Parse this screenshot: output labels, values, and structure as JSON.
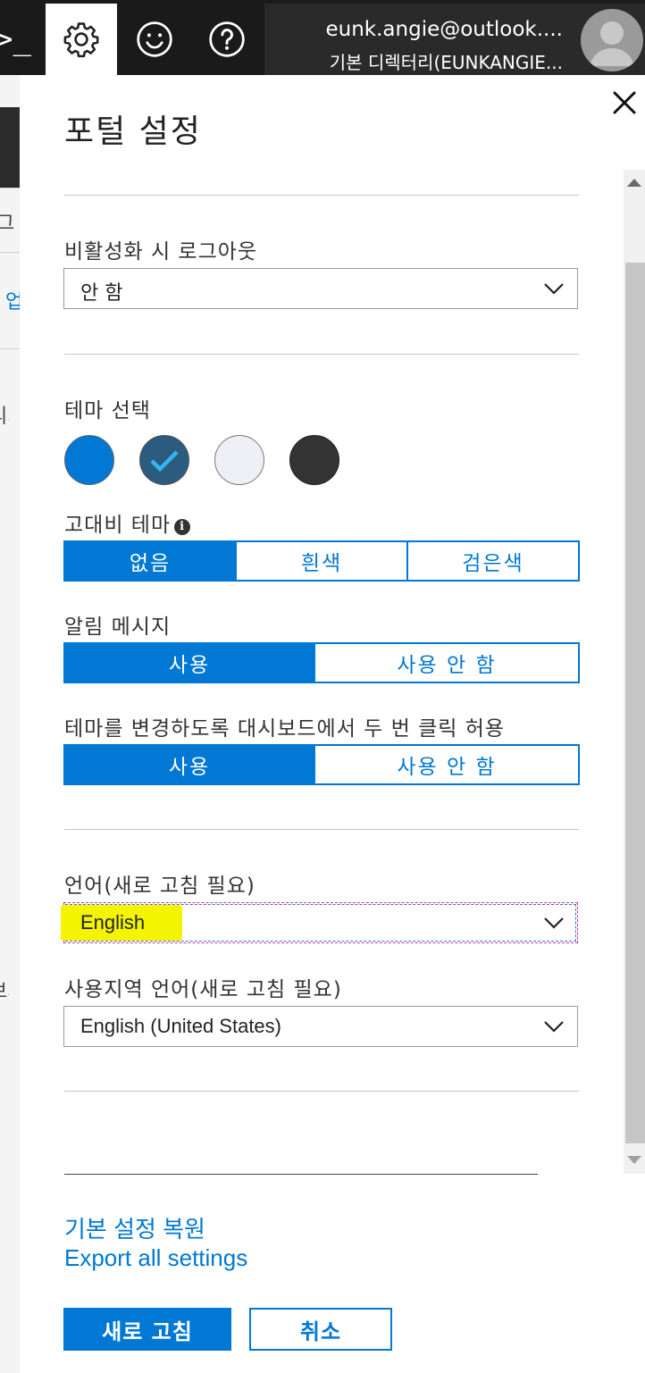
{
  "topbar": {
    "shell_glyph": ">_",
    "account_name": "eunk.angie@outlook....",
    "account_directory": "기본 디렉터리(EUNKANGIE..."
  },
  "background": {
    "chars": [
      "그",
      "업",
      "리지",
      "보시"
    ]
  },
  "panel": {
    "title": "포털 설정",
    "close_glyph": "✕",
    "logout": {
      "label": "비활성화 시 로그아웃",
      "value": "안 함"
    },
    "theme": {
      "label": "테마 선택",
      "swatches": [
        {
          "name": "blue",
          "color": "#0078d4",
          "selected": false
        },
        {
          "name": "dark-blue",
          "color": "#2b5b7e",
          "selected": true
        },
        {
          "name": "light",
          "color": "#eef0f6",
          "selected": false
        },
        {
          "name": "dark",
          "color": "#333333",
          "selected": false
        }
      ]
    },
    "high_contrast": {
      "label": "고대비 테마",
      "info": "i",
      "options": [
        "없음",
        "흰색",
        "검은색"
      ],
      "selected": 0
    },
    "toast": {
      "label": "알림 메시지",
      "options": [
        "사용",
        "사용 안 함"
      ],
      "selected": 0
    },
    "dblclick": {
      "label": "테마를 변경하도록 대시보드에서 두 번 클릭 허용",
      "options": [
        "사용",
        "사용 안 함"
      ],
      "selected": 0
    },
    "language": {
      "label": "언어(새로 고침 필요)",
      "value": "English"
    },
    "regional": {
      "label": "사용지역 언어(새로 고침 필요)",
      "value": "English (United States)"
    },
    "links": {
      "restore": "기본 설정 복원",
      "export": "Export all settings"
    },
    "buttons": {
      "refresh": "새로 고침",
      "cancel": "취소"
    }
  },
  "colors": {
    "accent": "#0078d4",
    "topbar": "#1a1a1a",
    "highlight": "#f4f400"
  }
}
